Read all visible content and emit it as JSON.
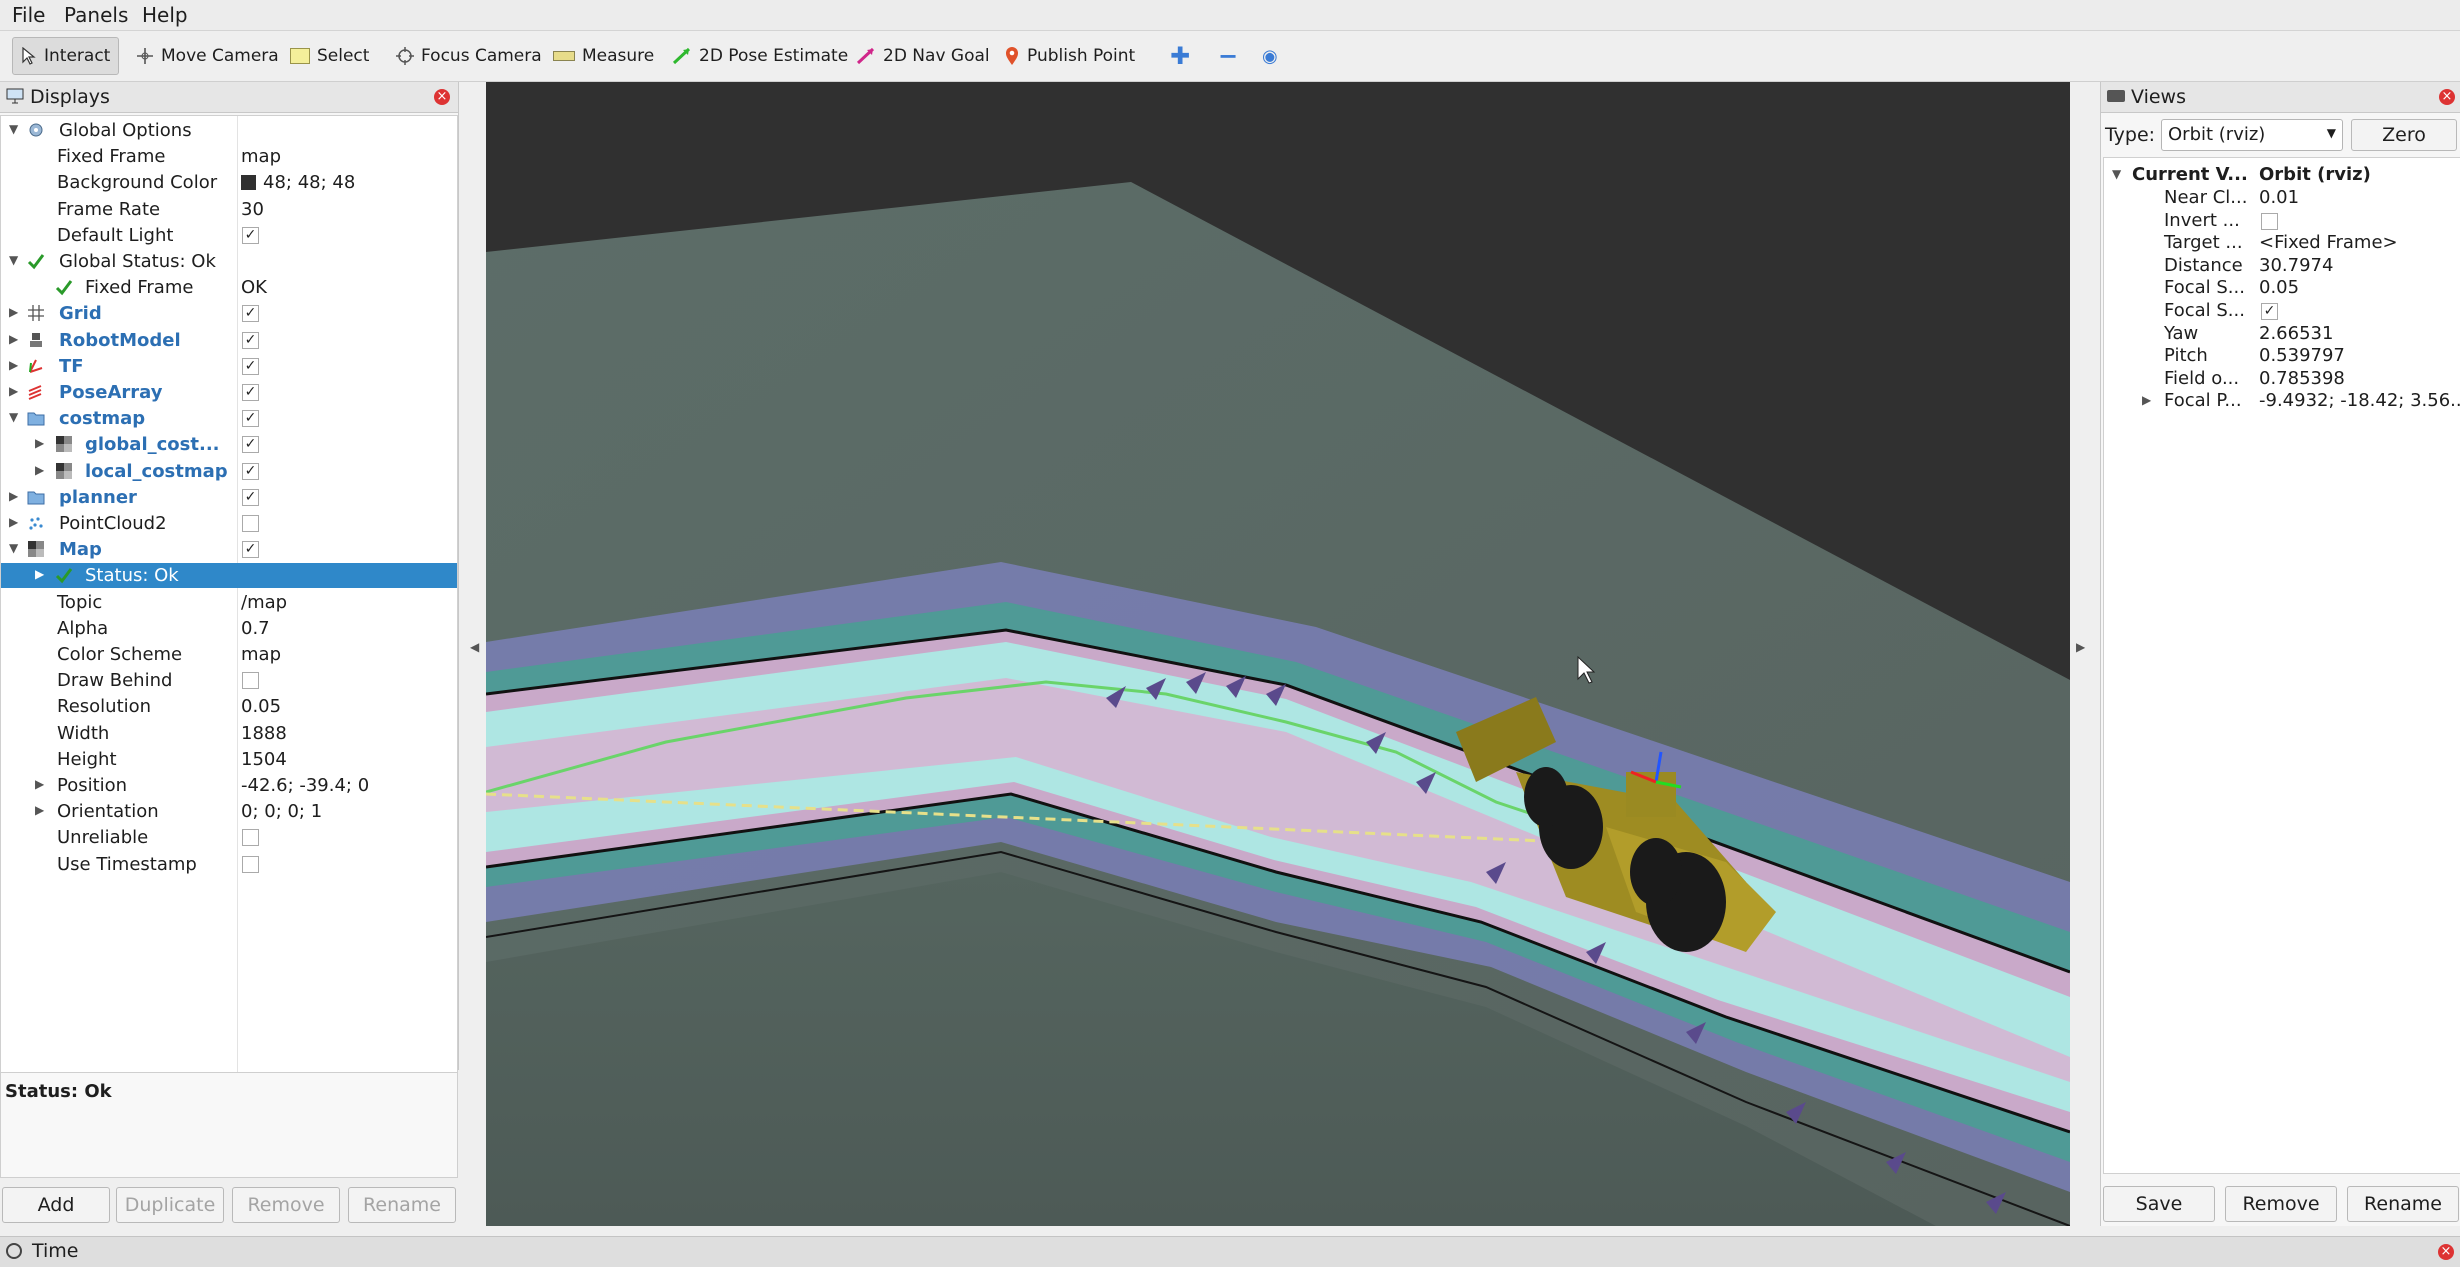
{
  "menu": [
    "File",
    "Panels",
    "Help"
  ],
  "toolbar": {
    "tools": [
      "Interact",
      "Move Camera",
      "Select",
      "Focus Camera",
      "Measure",
      "2D Pose Estimate",
      "2D Nav Goal",
      "Publish Point"
    ]
  },
  "displays": {
    "title": "Displays",
    "rows": [
      {
        "label": "Global Options",
        "value": ""
      },
      {
        "label": "Fixed Frame",
        "value": "map"
      },
      {
        "label": "Background Color",
        "value": "48; 48; 48"
      },
      {
        "label": "Frame Rate",
        "value": "30"
      },
      {
        "label": "Default Light",
        "value": ""
      },
      {
        "label": "Global Status: Ok",
        "value": ""
      },
      {
        "label": "Fixed Frame",
        "value": "OK"
      },
      {
        "label": "Grid",
        "value": ""
      },
      {
        "label": "RobotModel",
        "value": ""
      },
      {
        "label": "TF",
        "value": ""
      },
      {
        "label": "PoseArray",
        "value": ""
      },
      {
        "label": "costmap",
        "value": ""
      },
      {
        "label": "global_cost...",
        "value": ""
      },
      {
        "label": "local_costmap",
        "value": ""
      },
      {
        "label": "planner",
        "value": ""
      },
      {
        "label": "PointCloud2",
        "value": ""
      },
      {
        "label": "Map",
        "value": ""
      },
      {
        "label": "Status: Ok",
        "value": ""
      },
      {
        "label": "Topic",
        "value": "/map"
      },
      {
        "label": "Alpha",
        "value": "0.7"
      },
      {
        "label": "Color Scheme",
        "value": "map"
      },
      {
        "label": "Draw Behind",
        "value": ""
      },
      {
        "label": "Resolution",
        "value": "0.05"
      },
      {
        "label": "Width",
        "value": "1888"
      },
      {
        "label": "Height",
        "value": "1504"
      },
      {
        "label": "Position",
        "value": "-42.6; -39.4; 0"
      },
      {
        "label": "Orientation",
        "value": "0; 0; 0; 1"
      },
      {
        "label": "Unreliable",
        "value": ""
      },
      {
        "label": "Use Timestamp",
        "value": ""
      }
    ],
    "status_text": "Status: Ok",
    "buttons": [
      "Add",
      "Duplicate",
      "Remove",
      "Rename"
    ]
  },
  "views": {
    "title": "Views",
    "type_label": "Type:",
    "type_value": "Orbit (rviz)",
    "zero_label": "Zero",
    "header": {
      "label": "Current V...",
      "value": "Orbit (rviz)"
    },
    "rows": [
      {
        "label": "Near Cl...",
        "value": "0.01"
      },
      {
        "label": "Invert ...",
        "value": ""
      },
      {
        "label": "Target ...",
        "value": "<Fixed Frame>"
      },
      {
        "label": "Distance",
        "value": "30.7974"
      },
      {
        "label": "Focal S...",
        "value": "0.05"
      },
      {
        "label": "Focal S...",
        "value": ""
      },
      {
        "label": "Yaw",
        "value": "2.66531"
      },
      {
        "label": "Pitch",
        "value": "0.539797"
      },
      {
        "label": "Field o...",
        "value": "0.785398"
      },
      {
        "label": "Focal P...",
        "value": "-9.4932; -18.42; 3.56..."
      }
    ],
    "buttons": [
      "Save",
      "Remove",
      "Rename"
    ]
  },
  "time_panel": {
    "title": "Time"
  }
}
